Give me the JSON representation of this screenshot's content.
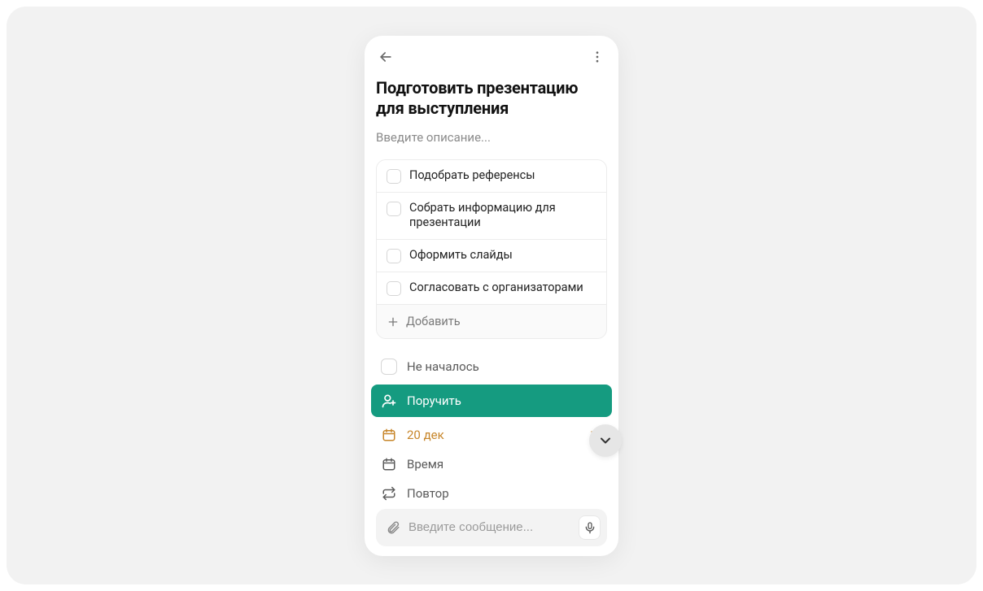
{
  "task": {
    "title": "Подготовить презентацию для выступления",
    "description_placeholder": "Введите описание..."
  },
  "checklist": {
    "items": [
      {
        "label": "Подобрать референсы"
      },
      {
        "label": "Собрать информацию для презентации"
      },
      {
        "label": "Оформить слайды"
      },
      {
        "label": "Согласовать с организаторами"
      }
    ],
    "add_label": "Добавить"
  },
  "meta": {
    "status_label": "Не началось",
    "assign_label": "Поручить",
    "date_label": "20 дек",
    "time_label": "Время",
    "repeat_label": "Повтор"
  },
  "message_input": {
    "placeholder": "Введите сообщение..."
  },
  "colors": {
    "accent_green": "#159b80",
    "accent_amber": "#c7862a"
  }
}
